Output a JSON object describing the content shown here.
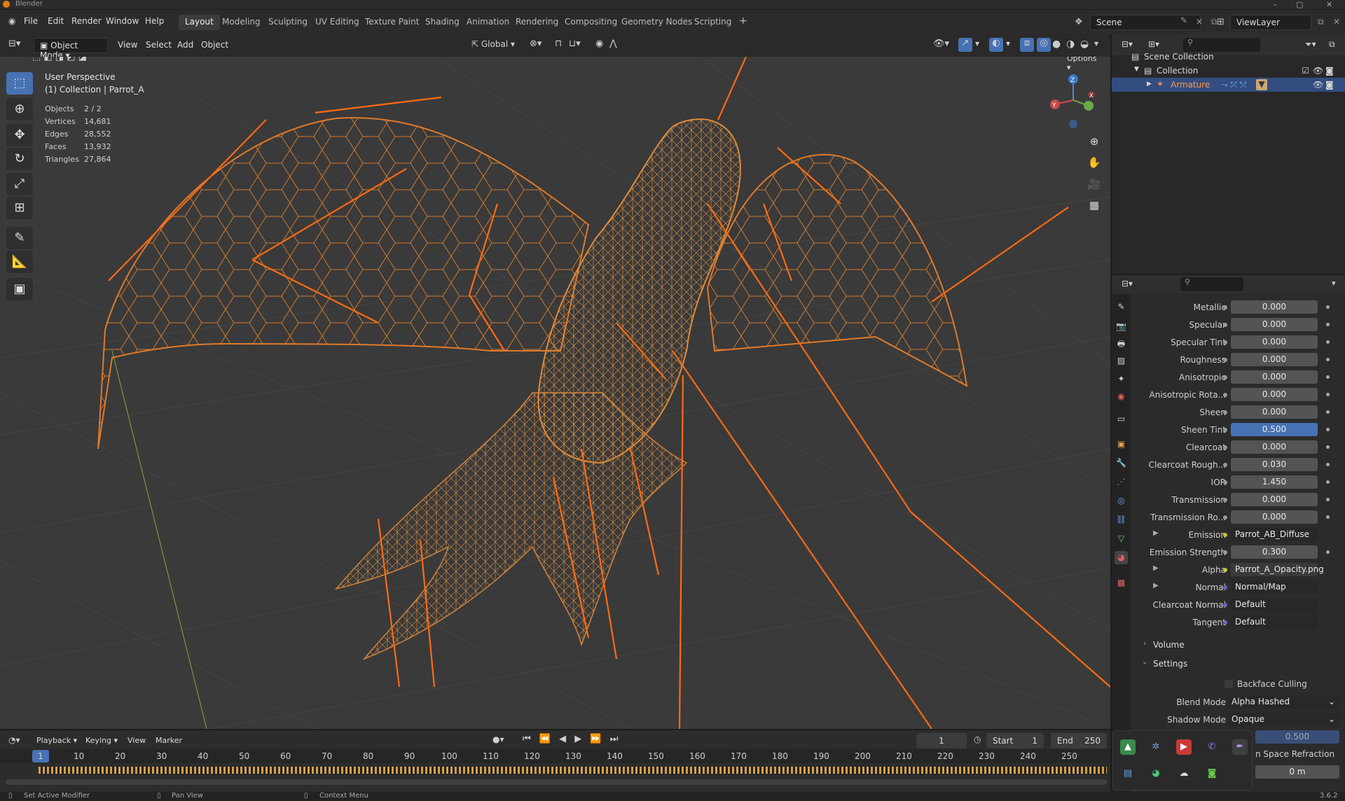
{
  "app": {
    "title": "Blender",
    "version": "3.6.2"
  },
  "menu": [
    "File",
    "Edit",
    "Render",
    "Window",
    "Help"
  ],
  "workspaces": [
    "Layout",
    "Modeling",
    "Sculpting",
    "UV Editing",
    "Texture Paint",
    "Shading",
    "Animation",
    "Rendering",
    "Compositing",
    "Geometry Nodes",
    "Scripting"
  ],
  "active_workspace": "Layout",
  "scene": {
    "label": "Scene",
    "view_layer": "ViewLayer"
  },
  "viewport_header": {
    "mode": "Object Mode",
    "menus": [
      "View",
      "Select",
      "Add",
      "Object"
    ],
    "transform": "Global",
    "options": "Options"
  },
  "overlay": {
    "view_name": "User Perspective",
    "collection": "(1) Collection | Parrot_A",
    "stats": [
      {
        "label": "Objects",
        "value": "2 / 2"
      },
      {
        "label": "Vertices",
        "value": "14,681"
      },
      {
        "label": "Edges",
        "value": "28,552"
      },
      {
        "label": "Faces",
        "value": "13,932"
      },
      {
        "label": "Triangles",
        "value": "27,864"
      }
    ]
  },
  "gizmo": {
    "x": "X",
    "y": "Y",
    "z": "Z"
  },
  "outliner": {
    "root": "Scene Collection",
    "collection": "Collection",
    "object": "Armature"
  },
  "properties": {
    "rows": [
      {
        "label": "Metallic",
        "value": "0.000",
        "type": "num"
      },
      {
        "label": "Specular",
        "value": "0.000",
        "type": "num"
      },
      {
        "label": "Specular Tint",
        "value": "0.000",
        "type": "num"
      },
      {
        "label": "Roughness",
        "value": "0.000",
        "type": "num"
      },
      {
        "label": "Anisotropic",
        "value": "0.000",
        "type": "num"
      },
      {
        "label": "Anisotropic Rota...",
        "value": "0.000",
        "type": "num"
      },
      {
        "label": "Sheen",
        "value": "0.000",
        "type": "num"
      },
      {
        "label": "Sheen Tint",
        "value": "0.500",
        "type": "hl"
      },
      {
        "label": "Clearcoat",
        "value": "0.000",
        "type": "num"
      },
      {
        "label": "Clearcoat Rough...",
        "value": "0.030",
        "type": "num"
      },
      {
        "label": "IOR",
        "value": "1.450",
        "type": "num"
      },
      {
        "label": "Transmission",
        "value": "0.000",
        "type": "num"
      },
      {
        "label": "Transmission Ro...",
        "value": "0.000",
        "type": "num"
      },
      {
        "label": "Emission",
        "value": "Parrot_AB_Diffuse",
        "type": "link",
        "expand": true
      },
      {
        "label": "Emission Strength",
        "value": "0.300",
        "type": "num"
      },
      {
        "label": "Alpha",
        "value": "Parrot_A_Opacity.png",
        "type": "link",
        "expand": true
      },
      {
        "label": "Normal",
        "value": "Normal/Map",
        "type": "link2",
        "expand": true
      },
      {
        "label": "Clearcoat Normal",
        "value": "Default",
        "type": "link2"
      },
      {
        "label": "Tangent",
        "value": "Default",
        "type": "link2"
      }
    ],
    "sections": {
      "volume": "Volume",
      "settings": "Settings"
    },
    "settings": {
      "backface": "Backface Culling",
      "blend_label": "Blend Mode",
      "blend_value": "Alpha Hashed",
      "shadow_label": "Shadow Mode",
      "shadow_value": "Opaque",
      "partial_value": "0.500",
      "partial_refraction": "n Space Refraction",
      "partial_depth": "0 m"
    }
  },
  "timeline": {
    "menus": [
      "Playback",
      "Keying",
      "View",
      "Marker"
    ],
    "current_frame": "1",
    "start_label": "Start",
    "start": "1",
    "end_label": "End",
    "end": "250",
    "ticks": [
      "1",
      "10",
      "20",
      "30",
      "40",
      "50",
      "60",
      "70",
      "80",
      "90",
      "100",
      "110",
      "120",
      "130",
      "140",
      "150",
      "160",
      "170",
      "180",
      "190",
      "200",
      "210",
      "220",
      "230",
      "240",
      "250"
    ]
  },
  "status": [
    "Set Active Modifier",
    "Pan View",
    "Context Menu"
  ],
  "colors": {
    "accent": "#4772b3",
    "wire": "#e07a2a",
    "bone": "#ff6a10",
    "viewport_bg": "#3a3a3a"
  }
}
